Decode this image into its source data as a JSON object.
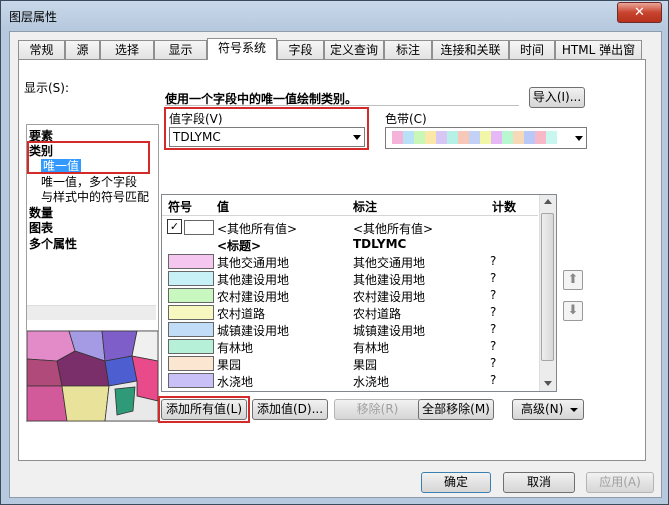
{
  "window": {
    "title": "图层属性",
    "close_label": "✕"
  },
  "tabs": [
    "常规",
    "源",
    "选择",
    "显示",
    "符号系统",
    "字段",
    "定义查询",
    "标注",
    "连接和关联",
    "时间",
    "HTML 弹出窗口"
  ],
  "active_tab": "符号系统",
  "show_label": "显示(S):",
  "tree": {
    "items": [
      "要素",
      "类别",
      "唯一值",
      "唯一值，多个字段",
      "与样式中的符号匹配",
      "数量",
      "图表",
      "多个属性"
    ]
  },
  "description": "使用一个字段中的唯一值绘制类别。",
  "import_button": "导入(I)...",
  "value_field": {
    "label": "值字段(V)",
    "value": "TDLYMC"
  },
  "color_ramp": {
    "label": "色带(C)",
    "colors": [
      "#f5b3d9",
      "#b8e0f7",
      "#c9f7b8",
      "#fbe7a8",
      "#d7c7f5",
      "#b7f0e6",
      "#f7c7b8",
      "#c3d1f7",
      "#f2f7a8",
      "#e7b8f7",
      "#b8f7cf",
      "#f7d9b8",
      "#b8c9f7",
      "#f7b8c8",
      "#c8f7f0"
    ]
  },
  "table": {
    "headers": {
      "symbol": "符号",
      "value": "值",
      "label": "标注",
      "count": "计数"
    },
    "other_row": {
      "value": "<其他所有值>",
      "label": "<其他所有值>"
    },
    "heading_row": {
      "value": "<标题>",
      "label": "TDLYMC"
    },
    "rows": [
      {
        "value": "其他交通用地",
        "label": "其他交通用地",
        "count": "?",
        "color": "#f5c7f0"
      },
      {
        "value": "其他建设用地",
        "label": "其他建设用地",
        "count": "?",
        "color": "#c8f0f7"
      },
      {
        "value": "农村建设用地",
        "label": "农村建设用地",
        "count": "?",
        "color": "#c9f7c0"
      },
      {
        "value": "农村道路",
        "label": "农村道路",
        "count": "?",
        "color": "#f7f7c0"
      },
      {
        "value": "城镇建设用地",
        "label": "城镇建设用地",
        "count": "?",
        "color": "#c0dcf7"
      },
      {
        "value": "有林地",
        "label": "有林地",
        "count": "?",
        "color": "#b7f0d8"
      },
      {
        "value": "果园",
        "label": "果园",
        "count": "?",
        "color": "#fbe6d2"
      },
      {
        "value": "水浇地",
        "label": "水浇地",
        "count": "?",
        "color": "#c8c0f7"
      }
    ]
  },
  "actions": {
    "add_all": "添加所有值(L)",
    "add": "添加值(D)...",
    "remove": "移除(R)",
    "remove_all": "全部移除(M)",
    "advanced": "高级(N)"
  },
  "footer": {
    "ok": "确定",
    "cancel": "取消",
    "apply": "应用(A)"
  },
  "highlight_color": "#d42a2a"
}
